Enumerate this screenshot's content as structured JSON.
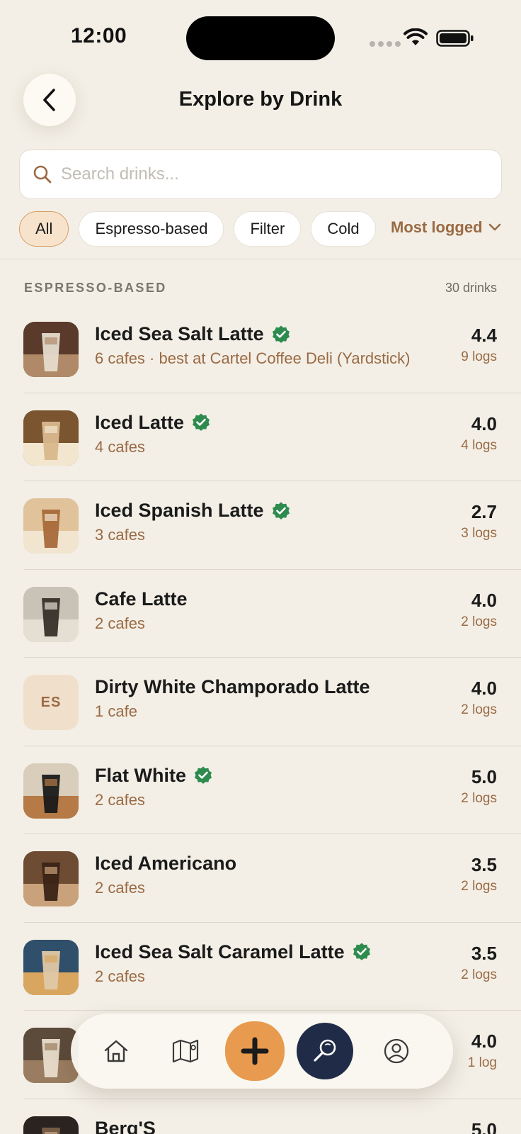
{
  "status": {
    "time": "12:00"
  },
  "header": {
    "title": "Explore by Drink"
  },
  "search": {
    "placeholder": "Search drinks..."
  },
  "filters": [
    {
      "label": "All",
      "active": true
    },
    {
      "label": "Espresso-based",
      "active": false
    },
    {
      "label": "Filter",
      "active": false
    },
    {
      "label": "Cold",
      "active": false
    }
  ],
  "sort": {
    "label": "Most logged"
  },
  "section": {
    "title": "ESPRESSO-BASED",
    "count": "30 drinks"
  },
  "drinks": [
    {
      "name": "Iced Sea Salt Latte",
      "verified": true,
      "sub": "6 cafes · best at Cartel Coffee Deli (Yardstick)",
      "rating": "4.4",
      "logs": "9 logs",
      "thumb": "photo",
      "colors": [
        "#5a3a2a",
        "#e6dccd",
        "#b08a68"
      ]
    },
    {
      "name": "Iced Latte",
      "verified": true,
      "sub": "4 cafes",
      "rating": "4.0",
      "logs": "4 logs",
      "thumb": "photo",
      "colors": [
        "#7a5530",
        "#d8b88c",
        "#f3e6cf"
      ]
    },
    {
      "name": "Iced Spanish Latte",
      "verified": true,
      "sub": "3 cafes",
      "rating": "2.7",
      "logs": "3 logs",
      "thumb": "photo",
      "colors": [
        "#e0c39a",
        "#a86a3a",
        "#f2e5d0"
      ]
    },
    {
      "name": "Cafe Latte",
      "verified": false,
      "sub": "2 cafes",
      "rating": "4.0",
      "logs": "2 logs",
      "thumb": "photo",
      "colors": [
        "#c9c2b6",
        "#3a2f2a",
        "#e4ded3"
      ]
    },
    {
      "name": "Dirty White Champorado Latte",
      "verified": false,
      "sub": "1 cafe",
      "rating": "4.0",
      "logs": "2 logs",
      "thumb": "initials",
      "initials": "ES"
    },
    {
      "name": "Flat White",
      "verified": true,
      "sub": "2 cafes",
      "rating": "5.0",
      "logs": "2 logs",
      "thumb": "photo",
      "colors": [
        "#d9cdbb",
        "#1a1a1a",
        "#b57a45"
      ]
    },
    {
      "name": "Iced Americano",
      "verified": false,
      "sub": "2 cafes",
      "rating": "3.5",
      "logs": "2 logs",
      "thumb": "photo",
      "colors": [
        "#6e4b33",
        "#3a2316",
        "#c9a17a"
      ]
    },
    {
      "name": "Iced Sea Salt Caramel Latte",
      "verified": true,
      "sub": "2 cafes",
      "rating": "3.5",
      "logs": "2 logs",
      "thumb": "photo",
      "colors": [
        "#2f4f6a",
        "#e0c8a8",
        "#d9a660"
      ]
    },
    {
      "name": "",
      "verified": false,
      "sub": "",
      "rating": "4.0",
      "logs": "1 log",
      "thumb": "photo",
      "colors": [
        "#5c4a3a",
        "#e8dccb",
        "#9a7d60"
      ]
    },
    {
      "name": "Berg'S",
      "verified": false,
      "sub": "",
      "rating": "5.0",
      "logs": "",
      "thumb": "photo",
      "colors": [
        "#2a2320",
        "#7a5f48",
        "#c9a885"
      ]
    }
  ],
  "nav": {
    "items": [
      {
        "icon": "home-icon"
      },
      {
        "icon": "map-icon"
      },
      {
        "icon": "plus-icon"
      },
      {
        "icon": "explore-icon"
      },
      {
        "icon": "profile-icon"
      }
    ]
  },
  "colors": {
    "accent": "#9a6a44",
    "orange": "#e89a4e",
    "navy": "#202c47",
    "verified": "#2e8b4e",
    "background": "#f3efe6"
  }
}
